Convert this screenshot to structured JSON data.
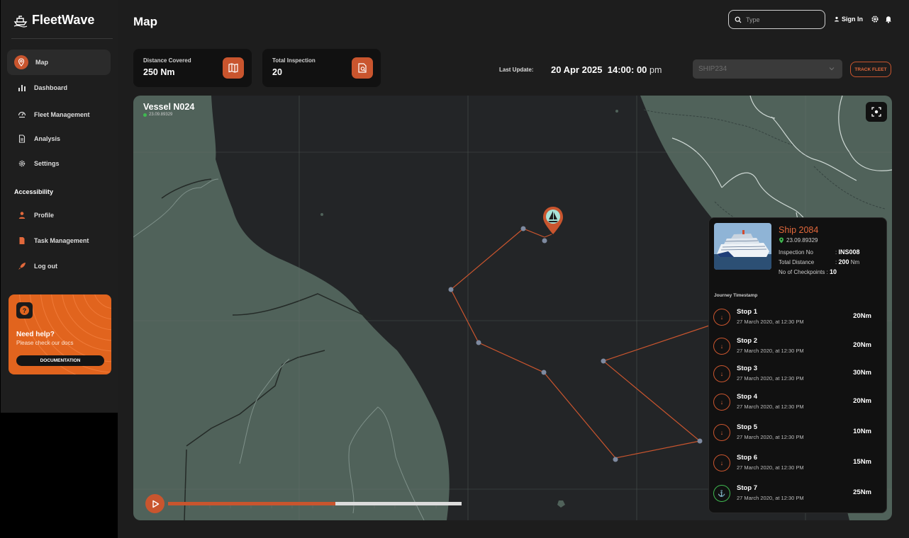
{
  "app": {
    "name": "FleetWave"
  },
  "nav": {
    "items": [
      {
        "label": "Map",
        "icon": "map-pin-icon"
      },
      {
        "label": "Dashboard",
        "icon": "bar-chart-icon"
      },
      {
        "label": "Fleet Management",
        "icon": "fleet-icon"
      },
      {
        "label": "Analysis",
        "icon": "document-icon"
      },
      {
        "label": "Settings",
        "icon": "gear-icon"
      }
    ],
    "accessibility_label": "Accessibility",
    "accessibility_items": [
      {
        "label": "Profile",
        "icon": "user-icon"
      },
      {
        "label": "Task Management",
        "icon": "file-icon"
      },
      {
        "label": "Log out",
        "icon": "rocket-icon"
      }
    ]
  },
  "help": {
    "title": "Need help?",
    "subtitle": "Please check our docs",
    "button": "DOCUMENTATION",
    "icon": "question-icon"
  },
  "header": {
    "title": "Map",
    "search_placeholder": "Type",
    "signin": "Sign In"
  },
  "stats": [
    {
      "label": "Distance Covered",
      "value": "250 Nm",
      "icon": "map-icon"
    },
    {
      "label": "Total Inspection",
      "value": "20",
      "icon": "inspection-icon"
    }
  ],
  "last_update": {
    "label": "Last Update:",
    "date": "20 Apr 2025",
    "time": "14:00: 00",
    "ampm": "pm"
  },
  "ship_select": {
    "value": "SHIP234"
  },
  "track_button": "TRACK FLEET",
  "vessel": {
    "name": "Vessel N024",
    "coord": "23.09.89329"
  },
  "timeline": {
    "progress": 0.57
  },
  "panel": {
    "ship_name": "Ship 2084",
    "coord": "23.09.89329",
    "inspection_label": "Inspection No",
    "inspection_value": "INS008",
    "distance_label": "Total Distance",
    "distance_value": "200",
    "distance_unit": "Nm",
    "checkpoints_label": "No of Checkpoints",
    "checkpoints_value": "10",
    "journey_label": "Journey Timestamp",
    "stops": [
      {
        "name": "Stop 1",
        "time": "27 March 2020, at 12:30 PM",
        "distance": "20Nm",
        "status": "done"
      },
      {
        "name": "Stop 2",
        "time": "27 March 2020, at 12:30 PM",
        "distance": "20Nm",
        "status": "done"
      },
      {
        "name": "Stop 3",
        "time": "27 March 2020, at 12:30 PM",
        "distance": "30Nm",
        "status": "done"
      },
      {
        "name": "Stop 4",
        "time": "27 March 2020, at 12:30 PM",
        "distance": "20Nm",
        "status": "done"
      },
      {
        "name": "Stop 5",
        "time": "27 March 2020, at 12:30 PM",
        "distance": "10Nm",
        "status": "done"
      },
      {
        "name": "Stop 6",
        "time": "27 March 2020, at 12:30 PM",
        "distance": "15Nm",
        "status": "done"
      },
      {
        "name": "Stop 7",
        "time": "27 March 2020, at 12:30 PM",
        "distance": "25Nm",
        "status": "current"
      }
    ]
  },
  "colors": {
    "accent": "#c9552e",
    "land": "#50625a",
    "water": "#232527",
    "success": "#3fb950"
  }
}
